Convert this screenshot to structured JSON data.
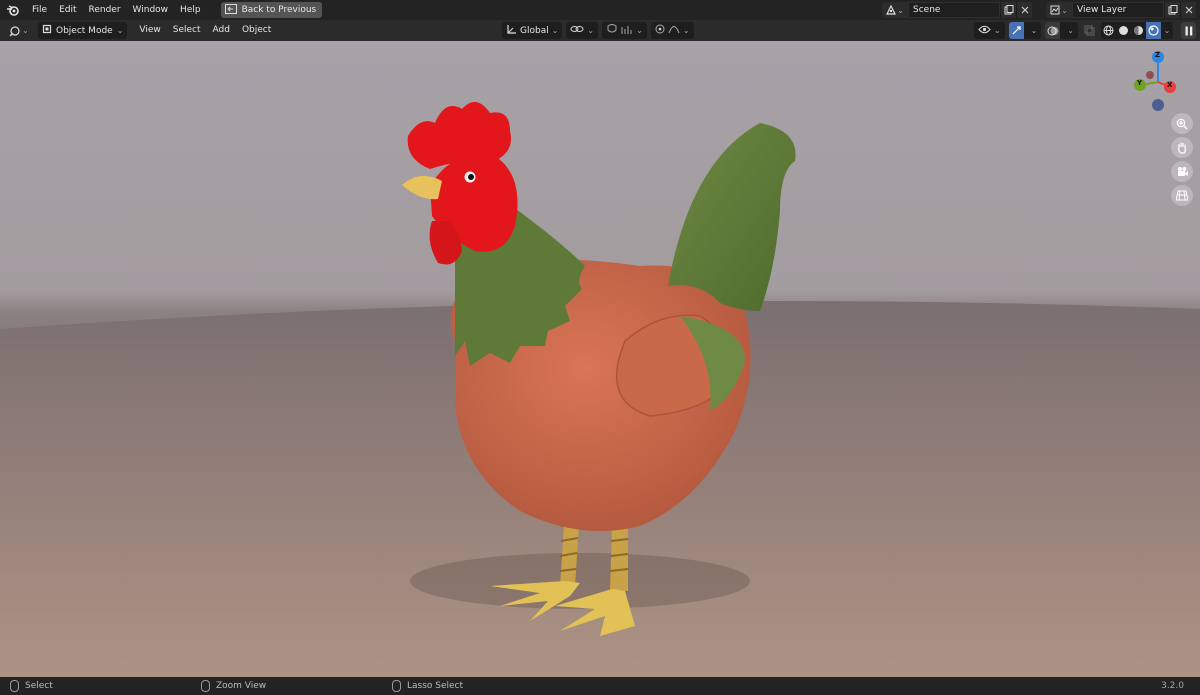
{
  "menu": {
    "items": [
      "File",
      "Edit",
      "Render",
      "Window",
      "Help"
    ],
    "back_label": "Back to Previous"
  },
  "scene": {
    "value": "Scene"
  },
  "view_layer": {
    "value": "View Layer"
  },
  "header": {
    "mode": "Object Mode",
    "menus": [
      "View",
      "Select",
      "Add",
      "Object"
    ],
    "orientation": "Global"
  },
  "gizmo": {
    "z_label": "Z",
    "x_label": "X",
    "y_label": "Y"
  },
  "status": {
    "select": "Select",
    "zoom": "Zoom View",
    "lasso": "Lasso Select",
    "version": "3.2.0"
  },
  "colors": {
    "accent": "#4772b3",
    "axis_x": "#e8403c",
    "axis_y": "#6fa324",
    "axis_z": "#2f85e0"
  },
  "icons": [
    "blender-logo-icon",
    "back-icon",
    "scene-icon",
    "view-layer-icon",
    "new-icon",
    "close-icon",
    "editor-type-icon",
    "mode-icon",
    "transform-icon",
    "link-icon",
    "snap-icon",
    "proportional-icon",
    "visibility-icon",
    "gizmo-icon",
    "overlay-icon",
    "xray-icon",
    "wireframe-icon",
    "solid-icon",
    "material-icon",
    "rendered-icon",
    "pause-icon",
    "zoom-icon",
    "hand-icon",
    "camera-icon",
    "grid-icon",
    "mouse-icon"
  ]
}
